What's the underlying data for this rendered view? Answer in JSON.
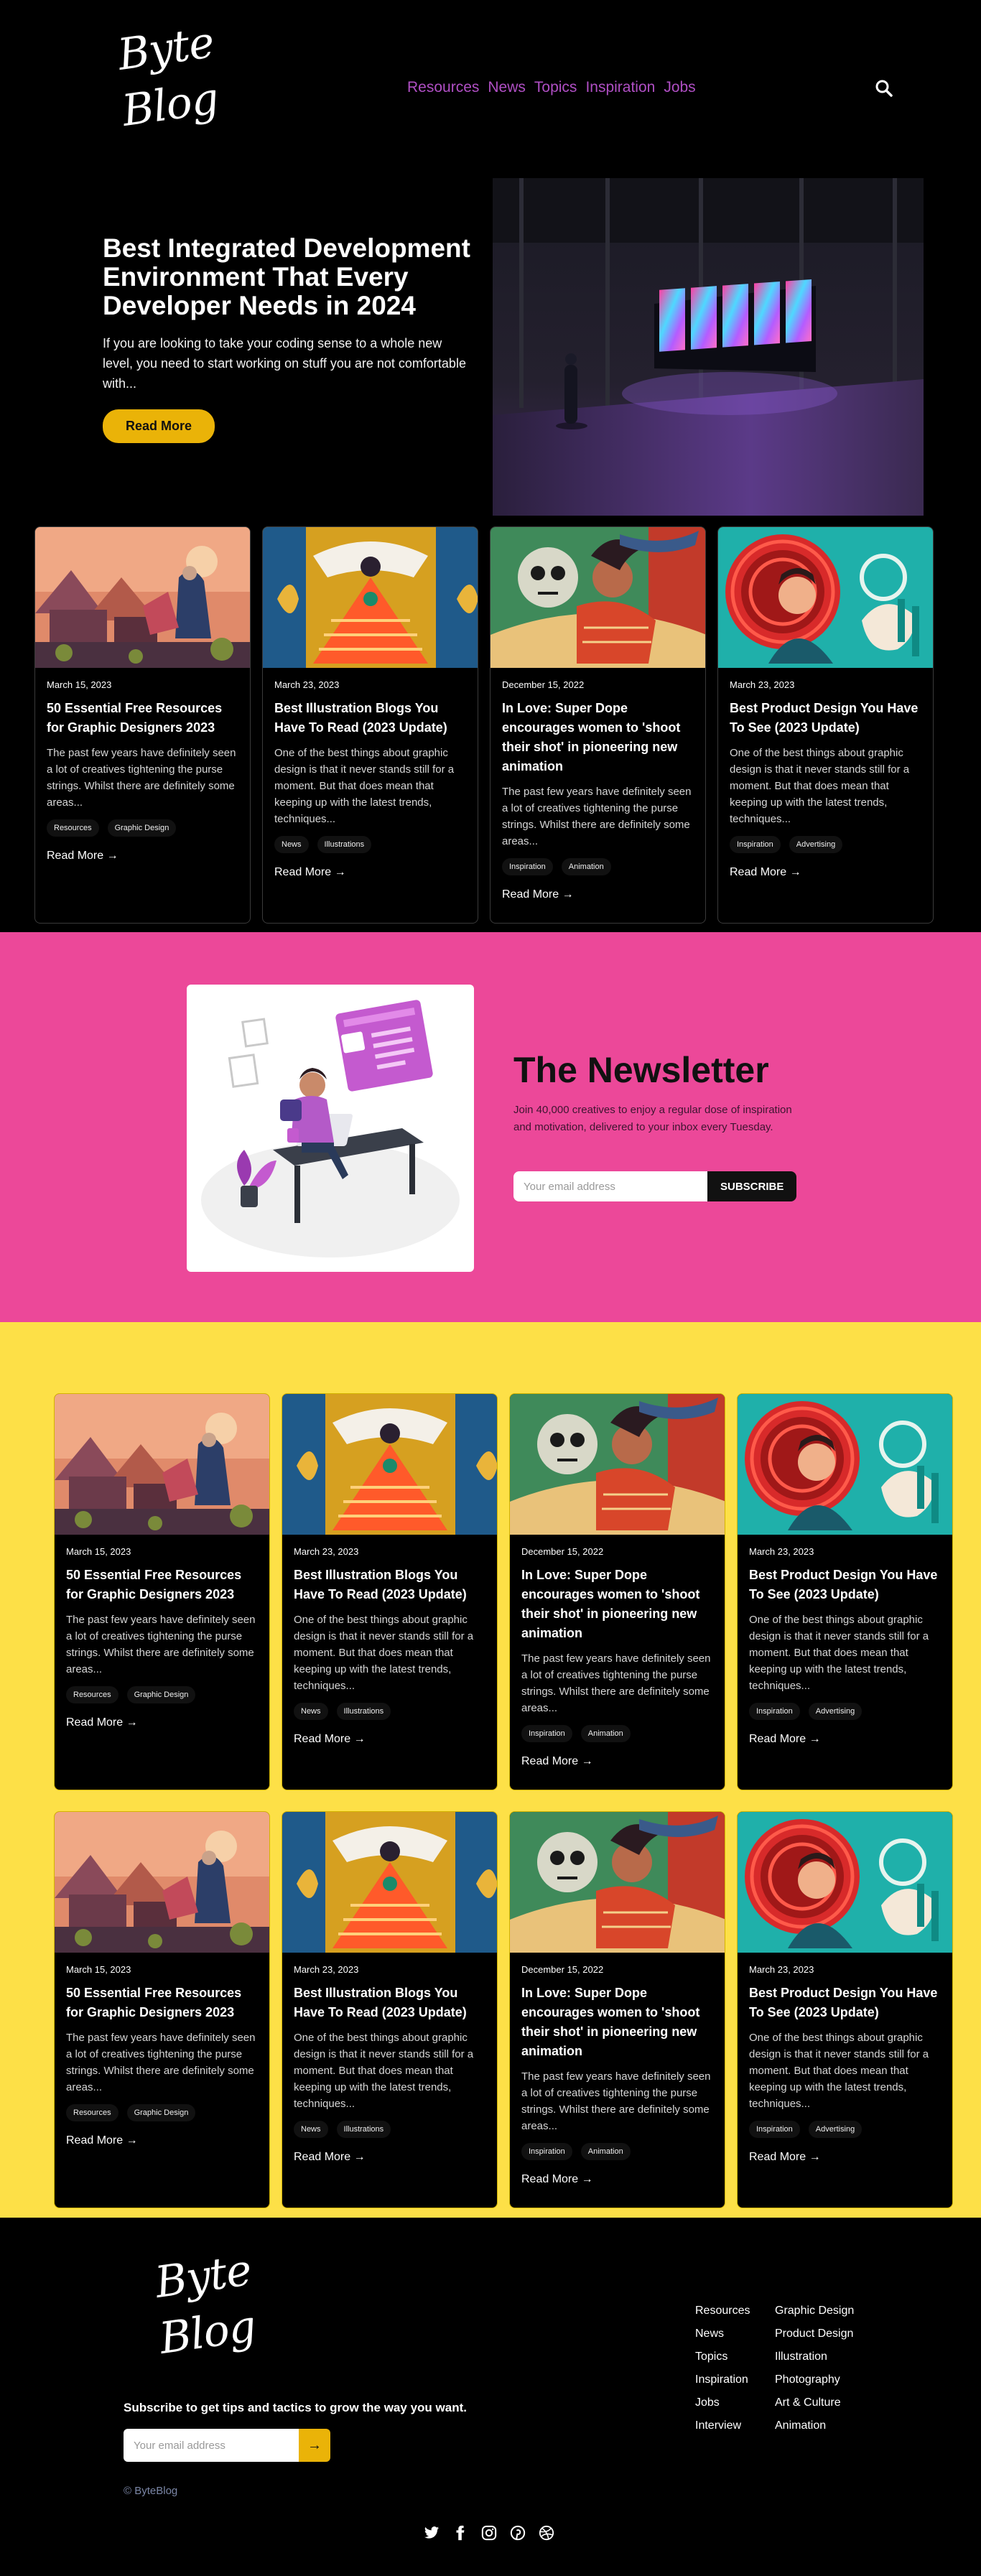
{
  "header": {
    "logo_line1": "Byte",
    "logo_line2": "Blog",
    "nav": [
      "Resources",
      "News",
      "Topics",
      "Inspiration",
      "Jobs"
    ]
  },
  "hero": {
    "title": "Best Integrated Development Environment That Every Developer Needs in 2024",
    "description": "If you are looking to take your coding sense to a whole new level, you need to start working on stuff you are not comfortable with...",
    "button": "Read More"
  },
  "cards": [
    {
      "date": "March 15, 2023",
      "title": "50 Essential Free Resources for Graphic Designers 2023",
      "excerpt": "The past few years have definitely seen a lot of creatives tightening the purse strings. Whilst there are definitely some areas...",
      "tags": [
        "Resources",
        "Graphic Design"
      ],
      "link": "Read More →",
      "image": "autumn-village-illustration"
    },
    {
      "date": "March 23, 2023",
      "title": "Best Illustration Blogs You Have To Read (2023 Update)",
      "excerpt": "One of the best things about graphic design is that it never stands still for a moment. But that does mean that keeping up with the latest trends, techniques...",
      "tags": [
        "News",
        "Illustrations"
      ],
      "link": "Read More →",
      "image": "folk-dancer-illustration"
    },
    {
      "date": "December 15, 2022",
      "title": "In Love: Super Dope encourages women to 'shoot their shot' in pioneering new animation",
      "excerpt": "The past few years have definitely seen a lot of creatives tightening the purse strings. Whilst there are definitely some areas...",
      "tags": [
        "Inspiration",
        "Animation"
      ],
      "link": "Read More →",
      "image": "skull-couple-illustration"
    },
    {
      "date": "March 23, 2023",
      "title": "Best Product Design You Have To See (2023 Update)",
      "excerpt": "One of the best things about graphic design is that it never stands still for a moment. But that does mean that keeping up with the latest trends, techniques...",
      "tags": [
        "Inspiration",
        "Advertising"
      ],
      "link": "Read More →",
      "image": "red-flower-woman-illustration"
    }
  ],
  "newsletter": {
    "title": "The Newsletter",
    "description": "Join 40,000 creatives to enjoy a regular dose of inspiration and motivation, delivered to your inbox every Tuesday.",
    "placeholder": "Your email address",
    "button": "SUBSCRIBE"
  },
  "footer": {
    "logo_line1": "Byte",
    "logo_line2": "Blog",
    "tagline": "Subscribe to get tips and tactics to grow the way you want.",
    "placeholder": "Your email address",
    "submit": "→",
    "copyright": "© ByteBlog",
    "col1": [
      "Resources",
      "News",
      "Topics",
      "Inspiration",
      "Jobs",
      "Interview"
    ],
    "col2": [
      "Graphic Design",
      "Product Design",
      "Illustration",
      "Photography",
      "Art & Culture",
      "Animation"
    ],
    "social": [
      "twitter-icon",
      "facebook-icon",
      "instagram-icon",
      "pinterest-icon",
      "dribbble-icon"
    ]
  },
  "colors": {
    "accent_yellow": "#eab308",
    "nav_purple": "#b04fc4",
    "newsletter_pink": "#ec4899",
    "section_yellow": "#fde047"
  }
}
